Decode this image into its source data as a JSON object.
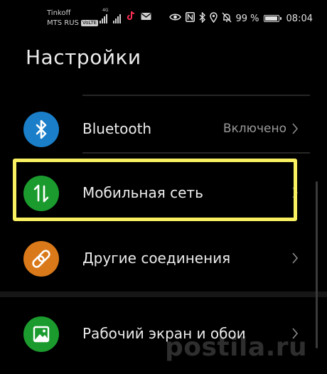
{
  "status_bar": {
    "carrier_1": "Tinkoff",
    "carrier_2": "MTS RUS",
    "volte_badge": "VoLTE",
    "network_tag": "4G",
    "battery_percent": "99 %",
    "battery_level": 0.99,
    "time": "08:04",
    "icons": [
      "signal-icon",
      "signal-icon",
      "tiktok-icon",
      "mail-icon",
      "eye-icon",
      "nfc-icon",
      "bluetooth-icon",
      "location-icon",
      "mute-icon",
      "battery-icon"
    ]
  },
  "page": {
    "title": "Настройки"
  },
  "settings": {
    "items": [
      {
        "label": "Bluetooth",
        "value": "Включено",
        "icon": "bluetooth-icon",
        "color": "#1a7ec9"
      },
      {
        "label": "Мобильная сеть",
        "value": "",
        "icon": "mobile-data-icon",
        "color": "#1b9b2e"
      },
      {
        "label": "Другие соединения",
        "value": "",
        "icon": "link-icon",
        "color": "#d9791a"
      },
      {
        "label": "Рабочий экран и обои",
        "value": "",
        "icon": "wallpaper-icon",
        "color": "#1b9b2e"
      }
    ]
  },
  "colors": {
    "background": "#000000",
    "highlight": "#f8f060"
  },
  "watermark": {
    "text": "postila.ru"
  }
}
